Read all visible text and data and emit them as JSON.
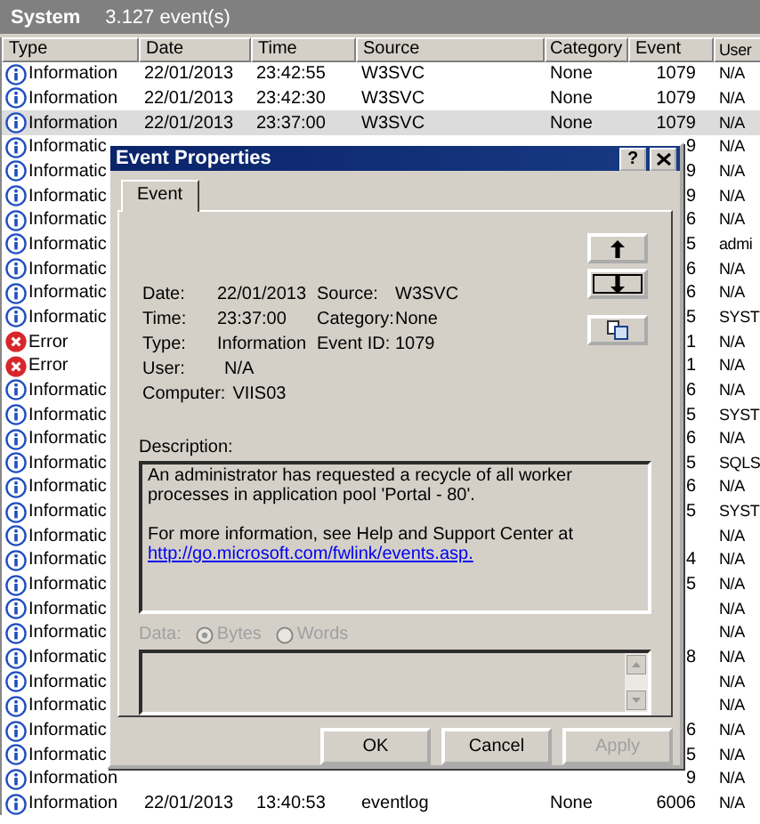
{
  "header": {
    "title": "System",
    "count": "3.127 event(s)"
  },
  "columns": [
    "Type",
    "Date",
    "Time",
    "Source",
    "Category",
    "Event",
    "User"
  ],
  "rows": [
    {
      "kind": "information",
      "type": "Information",
      "date": "22/01/2013",
      "time": "23:42:55",
      "source": "W3SVC",
      "category": "None",
      "event": "1079",
      "user": "N/A",
      "selected": false
    },
    {
      "kind": "information",
      "type": "Information",
      "date": "22/01/2013",
      "time": "23:42:30",
      "source": "W3SVC",
      "category": "None",
      "event": "1079",
      "user": "N/A",
      "selected": false
    },
    {
      "kind": "information",
      "type": "Information",
      "date": "22/01/2013",
      "time": "23:37:00",
      "source": "W3SVC",
      "category": "None",
      "event": "1079",
      "user": "N/A",
      "selected": true
    },
    {
      "kind": "information",
      "type": "Informatic",
      "event": "9",
      "user": "N/A",
      "selected": false
    },
    {
      "kind": "information",
      "type": "Informatic",
      "event": "9",
      "user": "N/A",
      "selected": false
    },
    {
      "kind": "information",
      "type": "Informatic",
      "event": "9",
      "user": "N/A",
      "selected": false
    },
    {
      "kind": "information",
      "type": "Informatic",
      "event": "6",
      "user": "N/A",
      "selected": false
    },
    {
      "kind": "information",
      "type": "Informatic",
      "event": "5",
      "user": "admi",
      "selected": false
    },
    {
      "kind": "information",
      "type": "Informatic",
      "event": "6",
      "user": "N/A",
      "selected": false
    },
    {
      "kind": "information",
      "type": "Informatic",
      "event": "6",
      "user": "N/A",
      "selected": false
    },
    {
      "kind": "information",
      "type": "Informatic",
      "event": "5",
      "user": "SYST",
      "selected": false
    },
    {
      "kind": "error",
      "type": "Error",
      "event": "1",
      "user": "N/A",
      "selected": false
    },
    {
      "kind": "error",
      "type": "Error",
      "event": "1",
      "user": "N/A",
      "selected": false
    },
    {
      "kind": "information",
      "type": "Informatic",
      "event": "6",
      "user": "N/A",
      "selected": false
    },
    {
      "kind": "information",
      "type": "Informatic",
      "event": "5",
      "user": "SYST",
      "selected": false
    },
    {
      "kind": "information",
      "type": "Informatic",
      "event": "6",
      "user": "N/A",
      "selected": false
    },
    {
      "kind": "information",
      "type": "Informatic",
      "event": "5",
      "user": "SQLS",
      "selected": false
    },
    {
      "kind": "information",
      "type": "Informatic",
      "event": "6",
      "user": "N/A",
      "selected": false
    },
    {
      "kind": "information",
      "type": "Informatic",
      "event": "5",
      "user": "SYST",
      "selected": false
    },
    {
      "kind": "information",
      "type": "Informatic",
      "user": "N/A",
      "selected": false
    },
    {
      "kind": "information",
      "type": "Informatic",
      "event": "4",
      "user": "N/A",
      "selected": false
    },
    {
      "kind": "information",
      "type": "Informatic",
      "event": "5",
      "user": "N/A",
      "selected": false
    },
    {
      "kind": "information",
      "type": "Informatic",
      "user": "N/A",
      "selected": false
    },
    {
      "kind": "information",
      "type": "Informatic",
      "user": "N/A",
      "selected": false
    },
    {
      "kind": "information",
      "type": "Informatic",
      "event": "8",
      "user": "N/A",
      "selected": false
    },
    {
      "kind": "information",
      "type": "Informatic",
      "user": "N/A",
      "selected": false
    },
    {
      "kind": "information",
      "type": "Informatic",
      "user": "N/A",
      "selected": false
    },
    {
      "kind": "information",
      "type": "Informatic",
      "event": "6",
      "user": "N/A",
      "selected": false
    },
    {
      "kind": "information",
      "type": "Informatic",
      "event": "5",
      "user": "N/A",
      "selected": false
    },
    {
      "kind": "information",
      "type": "Information",
      "event": "9",
      "user": "N/A",
      "selected": false
    },
    {
      "kind": "information",
      "type": "Information",
      "date": "22/01/2013",
      "time": "13:40:53",
      "source": "eventlog",
      "category": "None",
      "event": "6006",
      "user": "N/A",
      "selected": false
    }
  ],
  "dialog": {
    "title": "Event Properties",
    "help": "?",
    "tabs": [
      {
        "label": "Event",
        "selected": true
      }
    ],
    "fields": [
      [
        {
          "label": "Date:",
          "value": "22/01/2013"
        },
        {
          "label": "Source:",
          "value": "W3SVC"
        }
      ],
      [
        {
          "label": "Time:",
          "value": "23:37:00"
        },
        {
          "label": "Category:",
          "value": "None"
        }
      ],
      [
        {
          "label": "Type:",
          "value": "Information"
        },
        {
          "label": "Event ID:",
          "value": "1079"
        }
      ],
      [
        {
          "label": "User:",
          "value": "N/A"
        }
      ],
      [
        {
          "label": "Computer:",
          "value": "VIIS03"
        }
      ]
    ],
    "description_label": "Description:",
    "description": [
      "An administrator has requested a recycle of all worker processes in application pool 'Portal - 80'.",
      "For more information, see Help and Support Center at"
    ],
    "link": "http://go.microsoft.com/fwlink/events.asp.",
    "data": {
      "label": "Data:",
      "disabled": true,
      "options": [
        {
          "label": "Bytes",
          "selected": true
        },
        {
          "label": "Words",
          "selected": false
        }
      ]
    },
    "buttons": [
      {
        "label": "OK",
        "disabled": false
      },
      {
        "label": "Cancel",
        "disabled": false
      },
      {
        "label": "Apply",
        "disabled": true
      }
    ]
  }
}
